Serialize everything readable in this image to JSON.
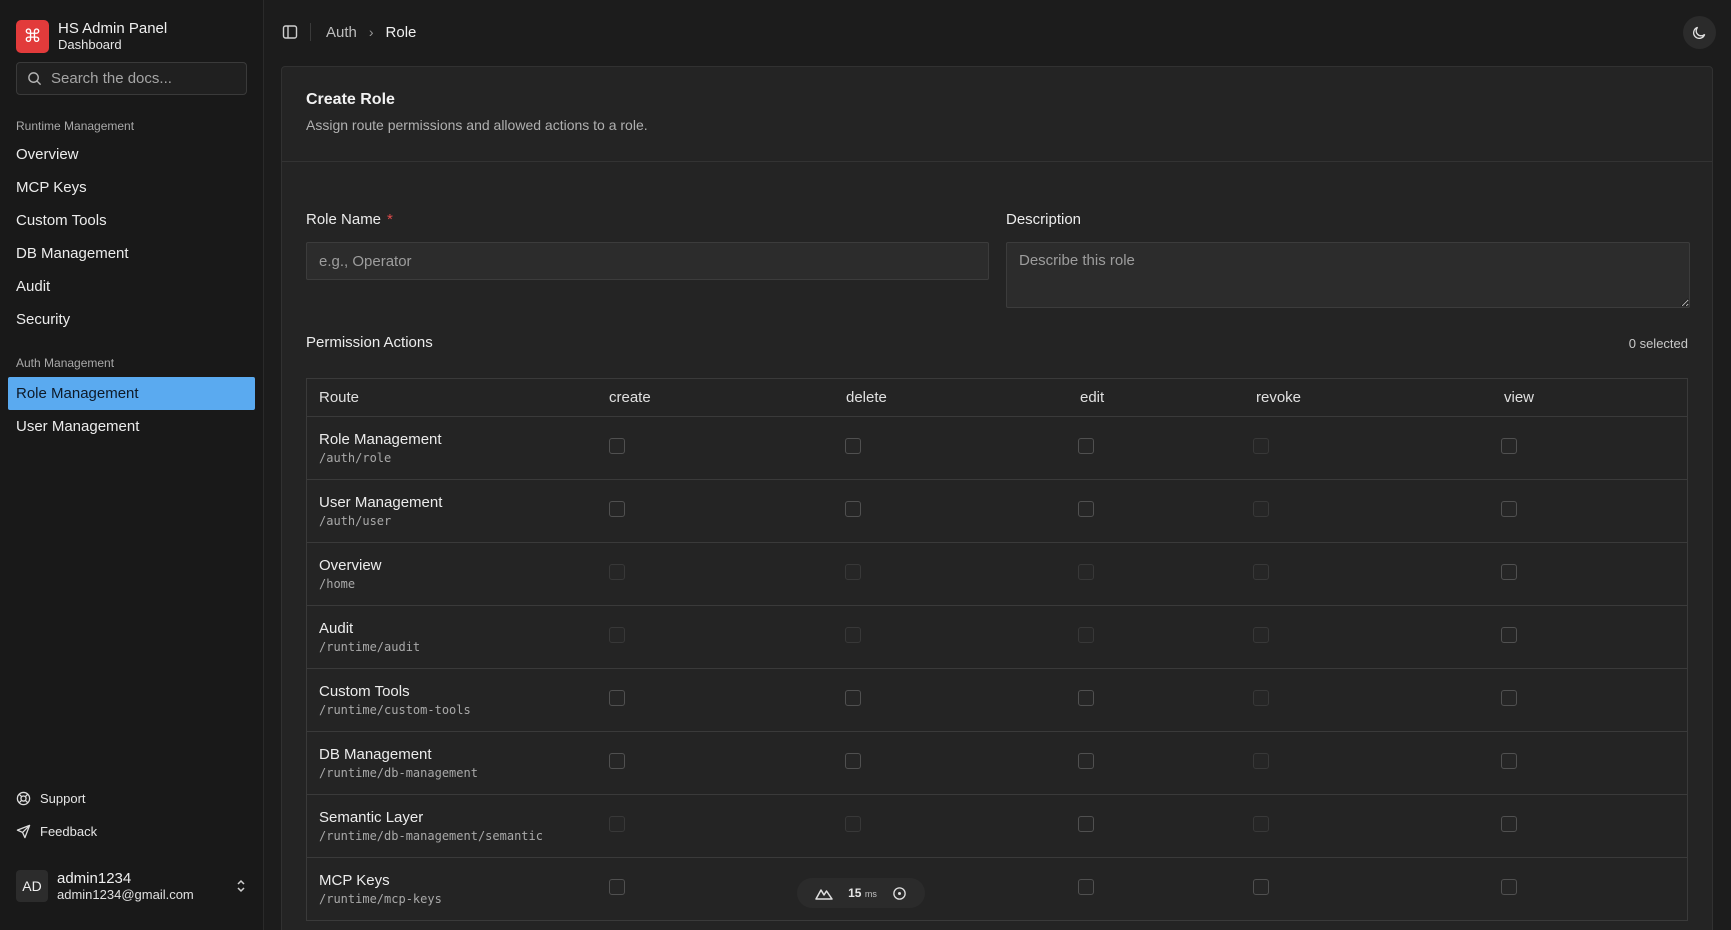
{
  "brand": {
    "title": "HS Admin Panel",
    "subtitle": "Dashboard",
    "logo_glyph": "⌘",
    "logo_color": "#e23b3b"
  },
  "search": {
    "placeholder": "Search the docs..."
  },
  "nav_groups": [
    {
      "label": "Runtime Management",
      "items": [
        "Overview",
        "MCP Keys",
        "Custom Tools",
        "DB Management",
        "Audit",
        "Security"
      ]
    },
    {
      "label": "Auth Management",
      "items": [
        "Role Management",
        "User Management"
      ]
    }
  ],
  "active_nav": "Role Management",
  "footer_links": {
    "support": "Support",
    "feedback": "Feedback"
  },
  "user": {
    "initials": "AD",
    "name": "admin1234",
    "email": "admin1234@gmail.com"
  },
  "breadcrumb": {
    "parent": "Auth",
    "current": "Role"
  },
  "card": {
    "title": "Create Role",
    "subtitle": "Assign route permissions and allowed actions to a role."
  },
  "form": {
    "role_name_label": "Role Name",
    "required_mark": "*",
    "role_name_placeholder": "e.g., Operator",
    "description_label": "Description",
    "description_placeholder": "Describe this role"
  },
  "permissions": {
    "label": "Permission Actions",
    "selected_count": "0 selected",
    "columns": [
      "Route",
      "create",
      "delete",
      "edit",
      "revoke",
      "view"
    ],
    "rows": [
      {
        "name": "Role Management",
        "path": "/auth/role",
        "dim": [
          false,
          false,
          false,
          true,
          false
        ]
      },
      {
        "name": "User Management",
        "path": "/auth/user",
        "dim": [
          false,
          false,
          false,
          true,
          false
        ]
      },
      {
        "name": "Overview",
        "path": "/home",
        "dim": [
          true,
          true,
          true,
          true,
          false
        ]
      },
      {
        "name": "Audit",
        "path": "/runtime/audit",
        "dim": [
          true,
          true,
          true,
          true,
          false
        ]
      },
      {
        "name": "Custom Tools",
        "path": "/runtime/custom-tools",
        "dim": [
          false,
          false,
          false,
          true,
          false
        ]
      },
      {
        "name": "DB Management",
        "path": "/runtime/db-management",
        "dim": [
          false,
          false,
          false,
          true,
          false
        ]
      },
      {
        "name": "Semantic Layer",
        "path": "/runtime/db-management/semantic",
        "dim": [
          true,
          true,
          false,
          true,
          false
        ]
      },
      {
        "name": "MCP Keys",
        "path": "/runtime/mcp-keys",
        "dim": [
          false,
          false,
          false,
          false,
          false
        ]
      }
    ]
  },
  "perf_badge": {
    "value": "15",
    "unit": "ms"
  }
}
